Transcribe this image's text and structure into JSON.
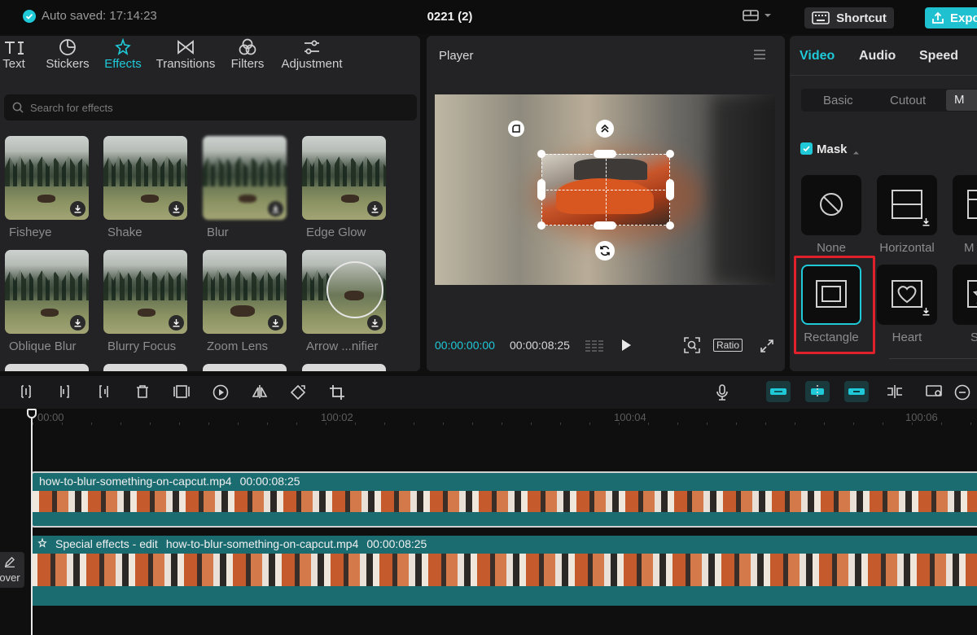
{
  "topbar": {
    "autosave": "Auto saved: 17:14:23",
    "project_title": "0221 (2)",
    "shortcut_label": "Shortcut",
    "export_label": "Expo"
  },
  "left_panel": {
    "tabs": [
      {
        "label": "Text",
        "icon": "text-icon"
      },
      {
        "label": "Stickers",
        "icon": "sticker-icon"
      },
      {
        "label": "Effects",
        "icon": "sparkle-icon",
        "active": true
      },
      {
        "label": "Transitions",
        "icon": "transition-icon"
      },
      {
        "label": "Filters",
        "icon": "filter-icon"
      },
      {
        "label": "Adjustment",
        "icon": "sliders-icon"
      }
    ],
    "search_placeholder": "Search for effects",
    "effects": [
      {
        "label": "Fisheye"
      },
      {
        "label": "Shake"
      },
      {
        "label": "Blur"
      },
      {
        "label": "Edge Glow"
      },
      {
        "label": "Oblique Blur"
      },
      {
        "label": "Blurry Focus"
      },
      {
        "label": "Zoom Lens"
      },
      {
        "label": "Arrow ...nifier"
      }
    ]
  },
  "player": {
    "title": "Player",
    "current_time": "00:00:00:00",
    "total_time": "00:00:08:25",
    "ratio_label": "Ratio"
  },
  "right_panel": {
    "tabs": [
      "Video",
      "Audio",
      "Speed"
    ],
    "subtabs": [
      "Basic",
      "Cutout",
      "M"
    ],
    "mask_title": "Mask",
    "mask_options": [
      {
        "label": "None"
      },
      {
        "label": "Horizontal"
      },
      {
        "label": "M"
      },
      {
        "label": "Rectangle",
        "selected": true
      },
      {
        "label": "Heart"
      },
      {
        "label": "S"
      }
    ]
  },
  "timeline": {
    "ruler": [
      "00:00",
      "100:02",
      "100:04",
      "100:06"
    ],
    "main_track": {
      "name": "how-to-blur-something-on-capcut.mp4",
      "duration": "00:00:08:25"
    },
    "fx_track": {
      "effect": "Special effects - edit",
      "name": "how-to-blur-something-on-capcut.mp4",
      "duration": "00:00:08:25"
    },
    "cover_label": "over"
  },
  "colors": {
    "accent": "#1fc9d8",
    "highlight": "#e0202a",
    "track": "#1b6c70"
  }
}
